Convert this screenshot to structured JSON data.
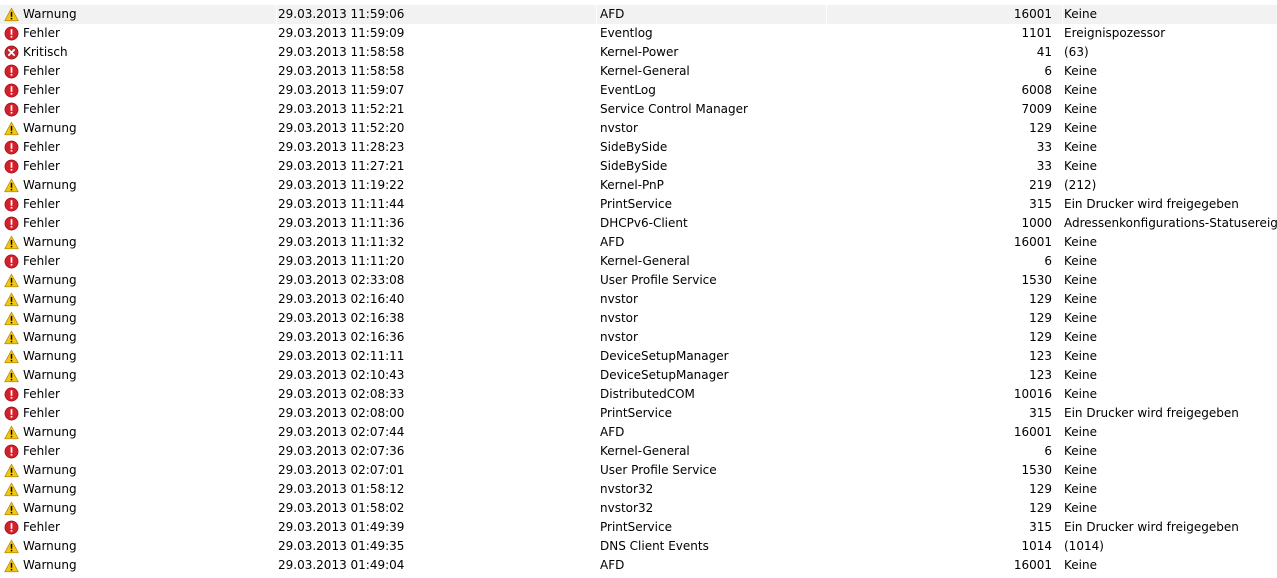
{
  "events": [
    {
      "level": "Warnung",
      "icon": "warning-icon",
      "date": "29.03.2013 11:59:06",
      "source": "AFD",
      "id": "16001",
      "task": "Keine"
    },
    {
      "level": "Fehler",
      "icon": "error-icon",
      "date": "29.03.2013 11:59:09",
      "source": "Eventlog",
      "id": "1101",
      "task": "Ereignispozessor"
    },
    {
      "level": "Kritisch",
      "icon": "critical-icon",
      "date": "29.03.2013 11:58:58",
      "source": "Kernel-Power",
      "id": "41",
      "task": "(63)"
    },
    {
      "level": "Fehler",
      "icon": "error-icon",
      "date": "29.03.2013 11:58:58",
      "source": "Kernel-General",
      "id": "6",
      "task": "Keine"
    },
    {
      "level": "Fehler",
      "icon": "error-icon",
      "date": "29.03.2013 11:59:07",
      "source": "EventLog",
      "id": "6008",
      "task": "Keine"
    },
    {
      "level": "Fehler",
      "icon": "error-icon",
      "date": "29.03.2013 11:52:21",
      "source": "Service Control Manager",
      "id": "7009",
      "task": "Keine"
    },
    {
      "level": "Warnung",
      "icon": "warning-icon",
      "date": "29.03.2013 11:52:20",
      "source": "nvstor",
      "id": "129",
      "task": "Keine"
    },
    {
      "level": "Fehler",
      "icon": "error-icon",
      "date": "29.03.2013 11:28:23",
      "source": "SideBySide",
      "id": "33",
      "task": "Keine"
    },
    {
      "level": "Fehler",
      "icon": "error-icon",
      "date": "29.03.2013 11:27:21",
      "source": "SideBySide",
      "id": "33",
      "task": "Keine"
    },
    {
      "level": "Warnung",
      "icon": "warning-icon",
      "date": "29.03.2013 11:19:22",
      "source": "Kernel-PnP",
      "id": "219",
      "task": "(212)"
    },
    {
      "level": "Fehler",
      "icon": "error-icon",
      "date": "29.03.2013 11:11:44",
      "source": "PrintService",
      "id": "315",
      "task": "Ein Drucker wird freigegeben"
    },
    {
      "level": "Fehler",
      "icon": "error-icon",
      "date": "29.03.2013 11:11:36",
      "source": "DHCPv6-Client",
      "id": "1000",
      "task": "Adressenkonfigurations-Statusereignis"
    },
    {
      "level": "Warnung",
      "icon": "warning-icon",
      "date": "29.03.2013 11:11:32",
      "source": "AFD",
      "id": "16001",
      "task": "Keine"
    },
    {
      "level": "Fehler",
      "icon": "error-icon",
      "date": "29.03.2013 11:11:20",
      "source": "Kernel-General",
      "id": "6",
      "task": "Keine"
    },
    {
      "level": "Warnung",
      "icon": "warning-icon",
      "date": "29.03.2013 02:33:08",
      "source": "User Profile Service",
      "id": "1530",
      "task": "Keine"
    },
    {
      "level": "Warnung",
      "icon": "warning-icon",
      "date": "29.03.2013 02:16:40",
      "source": "nvstor",
      "id": "129",
      "task": "Keine"
    },
    {
      "level": "Warnung",
      "icon": "warning-icon",
      "date": "29.03.2013 02:16:38",
      "source": "nvstor",
      "id": "129",
      "task": "Keine"
    },
    {
      "level": "Warnung",
      "icon": "warning-icon",
      "date": "29.03.2013 02:16:36",
      "source": "nvstor",
      "id": "129",
      "task": "Keine"
    },
    {
      "level": "Warnung",
      "icon": "warning-icon",
      "date": "29.03.2013 02:11:11",
      "source": "DeviceSetupManager",
      "id": "123",
      "task": "Keine"
    },
    {
      "level": "Warnung",
      "icon": "warning-icon",
      "date": "29.03.2013 02:10:43",
      "source": "DeviceSetupManager",
      "id": "123",
      "task": "Keine"
    },
    {
      "level": "Fehler",
      "icon": "error-icon",
      "date": "29.03.2013 02:08:33",
      "source": "DistributedCOM",
      "id": "10016",
      "task": "Keine"
    },
    {
      "level": "Fehler",
      "icon": "error-icon",
      "date": "29.03.2013 02:08:00",
      "source": "PrintService",
      "id": "315",
      "task": "Ein Drucker wird freigegeben"
    },
    {
      "level": "Warnung",
      "icon": "warning-icon",
      "date": "29.03.2013 02:07:44",
      "source": "AFD",
      "id": "16001",
      "task": "Keine"
    },
    {
      "level": "Fehler",
      "icon": "error-icon",
      "date": "29.03.2013 02:07:36",
      "source": "Kernel-General",
      "id": "6",
      "task": "Keine"
    },
    {
      "level": "Warnung",
      "icon": "warning-icon",
      "date": "29.03.2013 02:07:01",
      "source": "User Profile Service",
      "id": "1530",
      "task": "Keine"
    },
    {
      "level": "Warnung",
      "icon": "warning-icon",
      "date": "29.03.2013 01:58:12",
      "source": "nvstor32",
      "id": "129",
      "task": "Keine"
    },
    {
      "level": "Warnung",
      "icon": "warning-icon",
      "date": "29.03.2013 01:58:02",
      "source": "nvstor32",
      "id": "129",
      "task": "Keine"
    },
    {
      "level": "Fehler",
      "icon": "error-icon",
      "date": "29.03.2013 01:49:39",
      "source": "PrintService",
      "id": "315",
      "task": "Ein Drucker wird freigegeben"
    },
    {
      "level": "Warnung",
      "icon": "warning-icon",
      "date": "29.03.2013 01:49:35",
      "source": "DNS Client Events",
      "id": "1014",
      "task": "(1014)"
    },
    {
      "level": "Warnung",
      "icon": "warning-icon",
      "date": "29.03.2013 01:49:04",
      "source": "AFD",
      "id": "16001",
      "task": "Keine"
    }
  ],
  "colors": {
    "warning": "#f2c811",
    "error": "#d3202a",
    "critical": "#c4262e",
    "selected_row": "#f2f2f2"
  }
}
